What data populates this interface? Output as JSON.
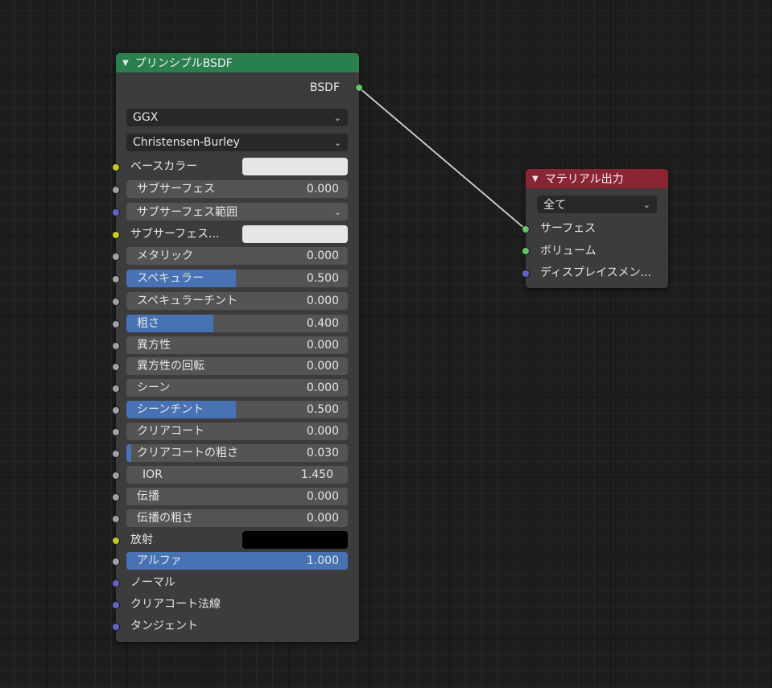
{
  "colors": {
    "socket_color": "#c7c729",
    "socket_float": "#a1a1a1",
    "socket_vector": "#6363c7",
    "socket_shader": "#63c763",
    "bsdf_header": "#2a7f4f",
    "output_header": "#8b2534",
    "slider_fill": "#4772b3"
  },
  "bsdf_node": {
    "title": "プリンシプルBSDF",
    "output_label": "BSDF",
    "distribution": "GGX",
    "subsurface_method": "Christensen-Burley",
    "inputs": {
      "base_color": {
        "label": "ベースカラー",
        "swatch": "#e6e6e6"
      },
      "subsurface": {
        "label": "サブサーフェス",
        "value": "0.000"
      },
      "subsurface_radius": {
        "label": "サブサーフェス範囲"
      },
      "subsurface_color": {
        "label": "サブサーフェス...",
        "swatch": "#e6e6e6"
      },
      "metallic": {
        "label": "メタリック",
        "value": "0.000",
        "fraction": 0.0
      },
      "specular": {
        "label": "スペキュラー",
        "value": "0.500",
        "fraction": 0.5
      },
      "specular_tint": {
        "label": "スペキュラーチント",
        "value": "0.000",
        "fraction": 0.0
      },
      "roughness": {
        "label": "粗さ",
        "value": "0.400",
        "fraction": 0.4
      },
      "anisotropic": {
        "label": "異方性",
        "value": "0.000",
        "fraction": 0.0
      },
      "anisotropic_rotation": {
        "label": "異方性の回転",
        "value": "0.000",
        "fraction": 0.0
      },
      "sheen": {
        "label": "シーン",
        "value": "0.000",
        "fraction": 0.0
      },
      "sheen_tint": {
        "label": "シーンチント",
        "value": "0.500",
        "fraction": 0.5
      },
      "clearcoat": {
        "label": "クリアコート",
        "value": "0.000",
        "fraction": 0.0
      },
      "clearcoat_roughness": {
        "label": "クリアコートの粗さ",
        "value": "0.030",
        "fraction": 0.03
      },
      "ior": {
        "label": "IOR",
        "value": "1.450"
      },
      "transmission": {
        "label": "伝播",
        "value": "0.000",
        "fraction": 0.0
      },
      "transmission_roughness": {
        "label": "伝播の粗さ",
        "value": "0.000",
        "fraction": 0.0
      },
      "emission": {
        "label": "放射",
        "swatch": "#000000"
      },
      "alpha": {
        "label": "アルファ",
        "value": "1.000",
        "fraction": 1.0
      },
      "normal": {
        "label": "ノーマル"
      },
      "clearcoat_normal": {
        "label": "クリアコート法線"
      },
      "tangent": {
        "label": "タンジェント"
      }
    }
  },
  "output_node": {
    "title": "マテリアル出力",
    "target": "全て",
    "inputs": {
      "surface": {
        "label": "サーフェス"
      },
      "volume": {
        "label": "ボリューム"
      },
      "displacement": {
        "label": "ディスプレイスメン..."
      }
    }
  }
}
